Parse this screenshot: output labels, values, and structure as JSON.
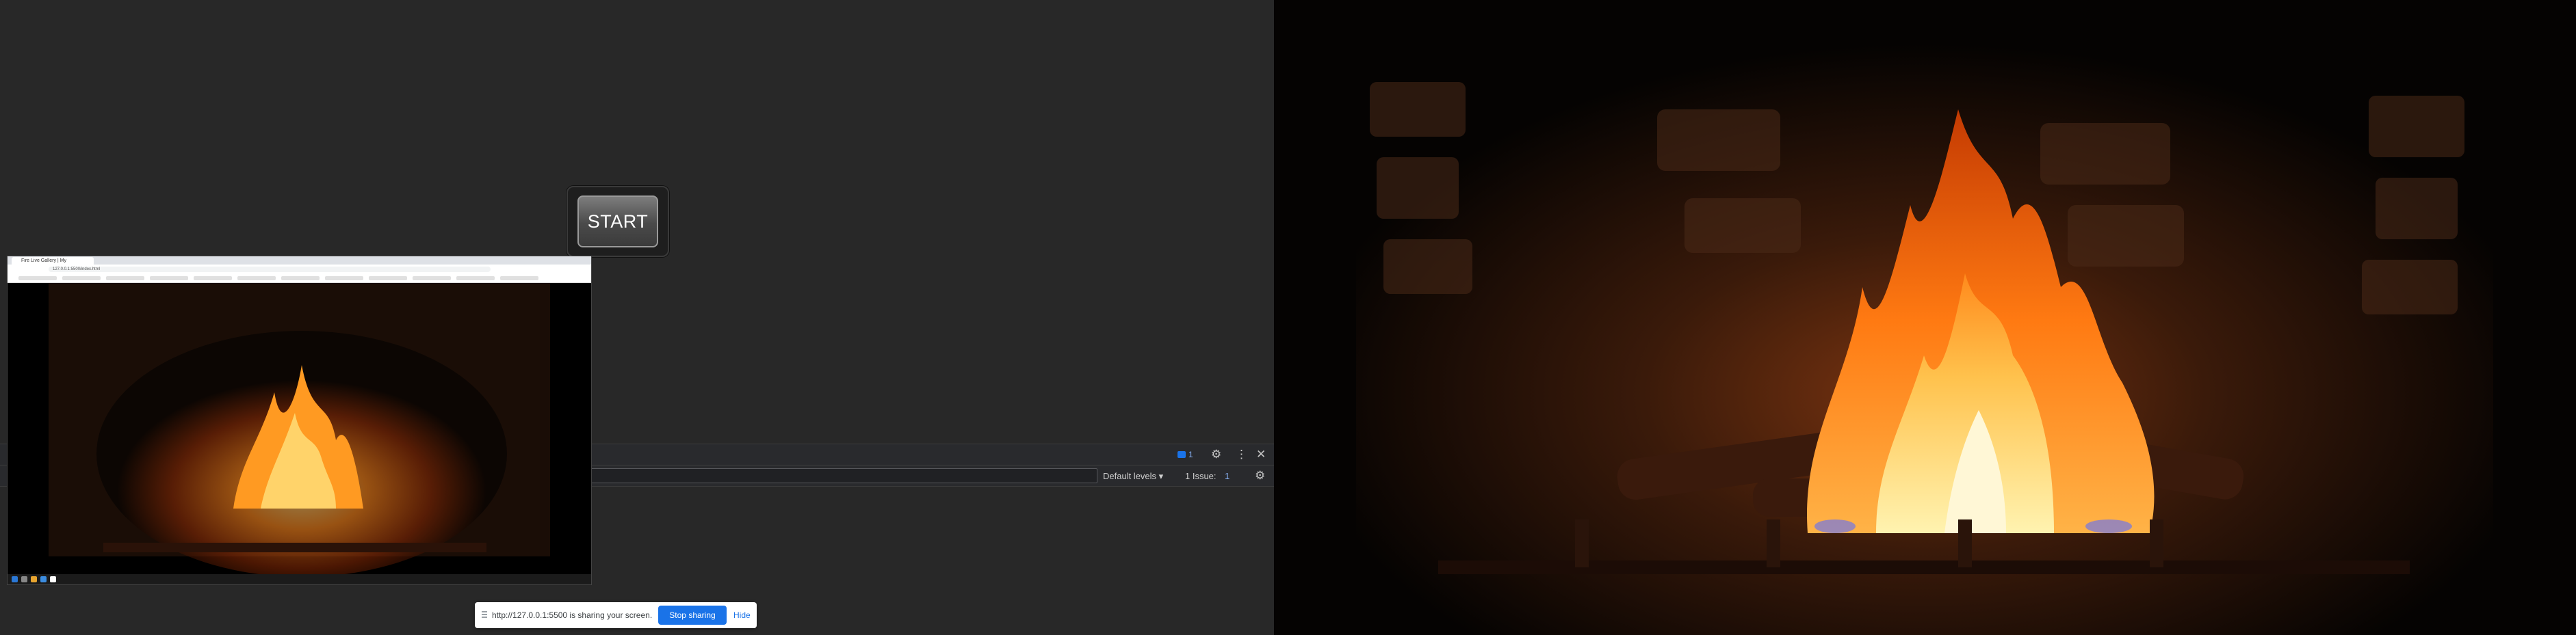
{
  "start_button": {
    "label": "START"
  },
  "devtools": {
    "message_count": "1",
    "levels_dropdown": "Default levels ▾",
    "issues_label": "1 Issue:",
    "issues_count": "1"
  },
  "thumbnail": {
    "tab_title": "Fire Live Gallery | My",
    "url": "127.0.0.1:5500/index.html"
  },
  "share_bar": {
    "message": "http://127.0.0.1:5500 is sharing your screen.",
    "stop_label": "Stop sharing",
    "hide_label": "Hide"
  },
  "colors": {
    "background": "#282828",
    "devtools": "#292a2d",
    "accent_blue": "#1a73e8",
    "fire_orange": "#ff8a1c"
  },
  "icons": [
    "gear-icon",
    "more-vert-icon",
    "close-icon",
    "message-icon",
    "drag-handle-icon"
  ]
}
